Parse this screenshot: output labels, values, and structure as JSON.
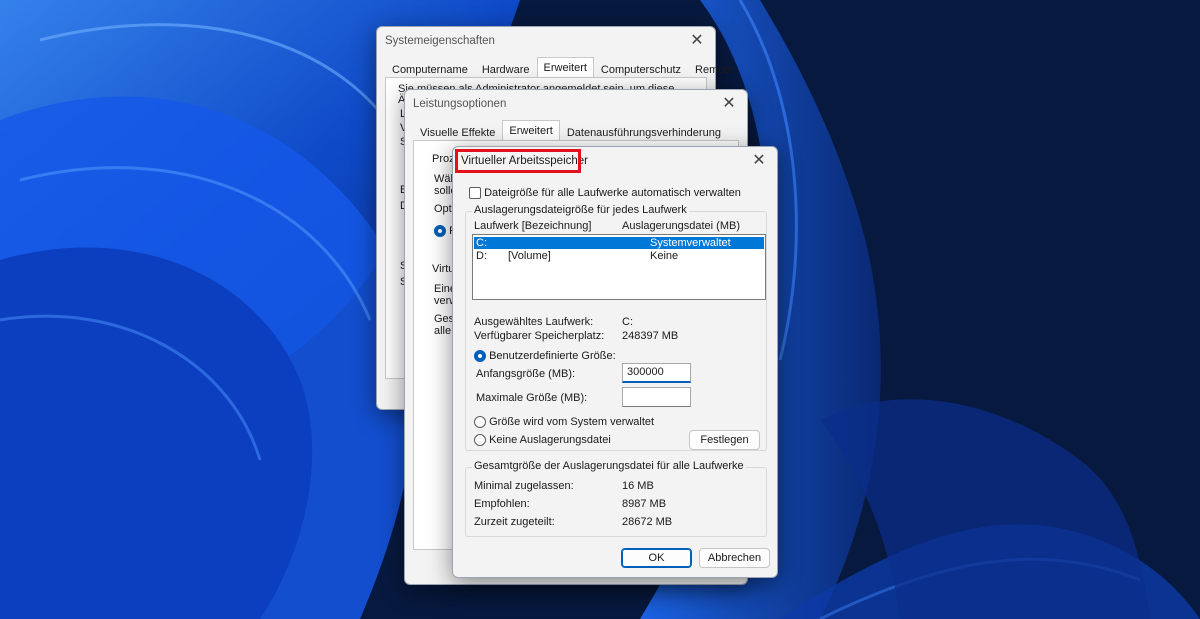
{
  "windows": {
    "system_properties": {
      "title": "Systemeigenschaften",
      "tabs": [
        "Computername",
        "Hardware",
        "Erweitert",
        "Computerschutz",
        "Remote"
      ],
      "active_tab": "Erweitert",
      "visible_text": "Sie müssen als Administrator angemeldet sein, um diese Änderungen d",
      "left_letters": [
        "L",
        "V",
        "S",
        "B",
        "D",
        "S",
        "S"
      ]
    },
    "performance_options": {
      "title": "Leistungsoptionen",
      "tabs": [
        "Visuelle Effekte",
        "Erweitert",
        "Datenausführungsverhinderung"
      ],
      "active_tab": "Erweitert",
      "fragments": [
        "Proze",
        "Wäh",
        "solle",
        "Opti",
        "P",
        "Virtu",
        "Eine",
        "verw",
        "Gesa",
        "alle"
      ]
    },
    "virtual_memory": {
      "title": "Virtueller Arbeitsspeicher",
      "auto_manage_label": "Dateigröße für alle Laufwerke automatisch verwalten",
      "auto_manage_checked": false,
      "per_drive_group": "Auslagerungsdateigröße für jedes Laufwerk",
      "columns": [
        "Laufwerk [Bezeichnung]",
        "Auslagerungsdatei (MB)"
      ],
      "drives": [
        {
          "drive": "C:",
          "label": "",
          "paging": "Systemverwaltet",
          "selected": true
        },
        {
          "drive": "D:",
          "label": "[Volume]",
          "paging": "Keine",
          "selected": false
        }
      ],
      "selected_drive_label": "Ausgewähltes Laufwerk:",
      "selected_drive_value": "C:",
      "free_space_label": "Verfügbarer Speicherplatz:",
      "free_space_value": "248397 MB",
      "custom_size_label": "Benutzerdefinierte Größe:",
      "initial_size_label": "Anfangsgröße (MB):",
      "initial_size_value": "300000",
      "max_size_label": "Maximale Größe (MB):",
      "max_size_value": "",
      "system_managed_label": "Größe wird vom System verwaltet",
      "no_paging_label": "Keine Auslagerungsdatei",
      "selected_option": "custom",
      "set_button": "Festlegen",
      "total_group": "Gesamtgröße der Auslagerungsdatei für alle Laufwerke",
      "min_allowed_label": "Minimal zugelassen:",
      "min_allowed_value": "16 MB",
      "recommended_label": "Empfohlen:",
      "recommended_value": "8987 MB",
      "current_label": "Zurzeit zugeteilt:",
      "current_value": "28672 MB",
      "ok_button": "OK",
      "cancel_button": "Abbrechen"
    }
  },
  "colors": {
    "highlight_border": "#e3111b",
    "selection": "#0078d7",
    "accent": "#005fb8"
  }
}
